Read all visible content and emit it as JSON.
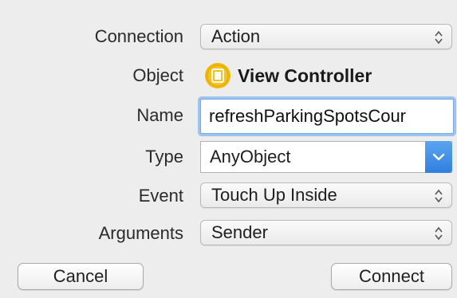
{
  "form": {
    "connection": {
      "label": "Connection",
      "value": "Action"
    },
    "object": {
      "label": "Object",
      "value": "View Controller",
      "icon": "view-controller-icon"
    },
    "name": {
      "label": "Name",
      "value": "refreshParkingSpotsCour"
    },
    "type": {
      "label": "Type",
      "value": "AnyObject"
    },
    "event": {
      "label": "Event",
      "value": "Touch Up Inside"
    },
    "arguments": {
      "label": "Arguments",
      "value": "Sender"
    }
  },
  "buttons": {
    "cancel": "Cancel",
    "connect": "Connect"
  },
  "colors": {
    "accent": "#2f7fe0",
    "focus_ring": "#9cc3f2",
    "icon_yellow": "#f5b800",
    "background": "#ededed"
  }
}
